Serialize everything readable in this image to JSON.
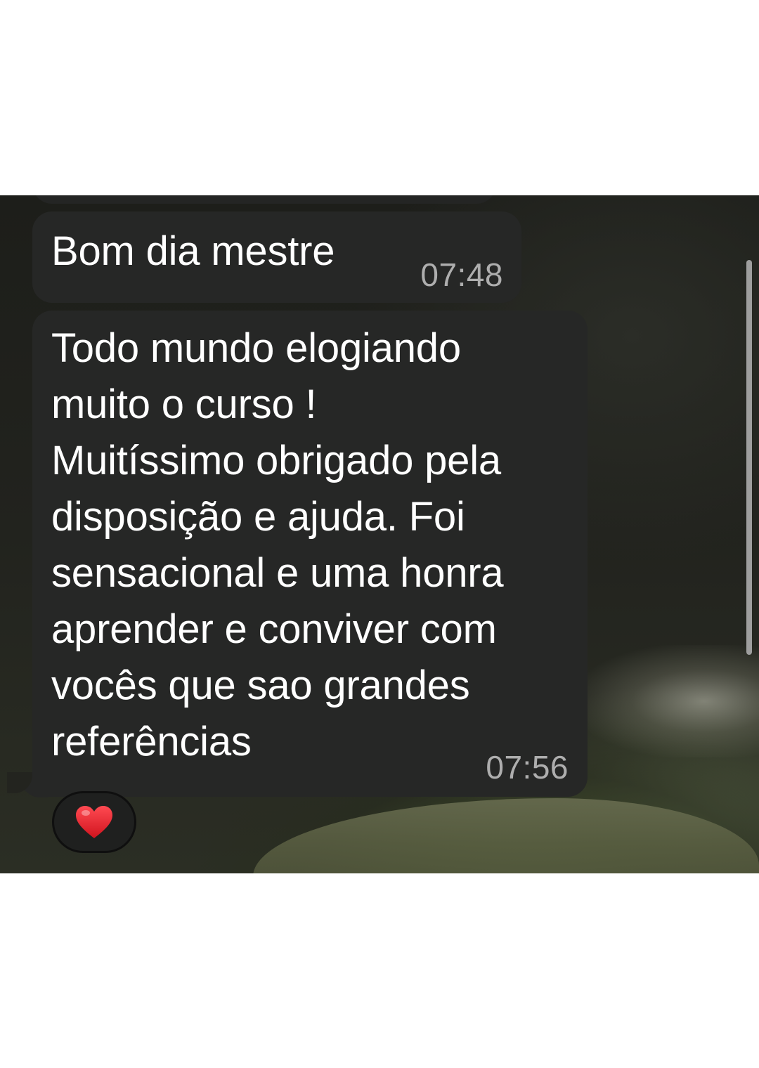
{
  "messages": [
    {
      "text": "Bom dia mestre",
      "time": "07:48"
    },
    {
      "text": "Todo mundo elogiando\nmuito o curso !\nMuitíssimo obrigado pela\ndisposição e ajuda. Foi\nsensacional e uma honra\naprender e conviver com\nvocês que sao grandes\nreferências",
      "time": "07:56",
      "reaction": "heart-icon"
    }
  ],
  "colors": {
    "bubble": "#262726",
    "text": "#ffffff",
    "time": "#aeaeae",
    "heart": "#e0242c"
  }
}
